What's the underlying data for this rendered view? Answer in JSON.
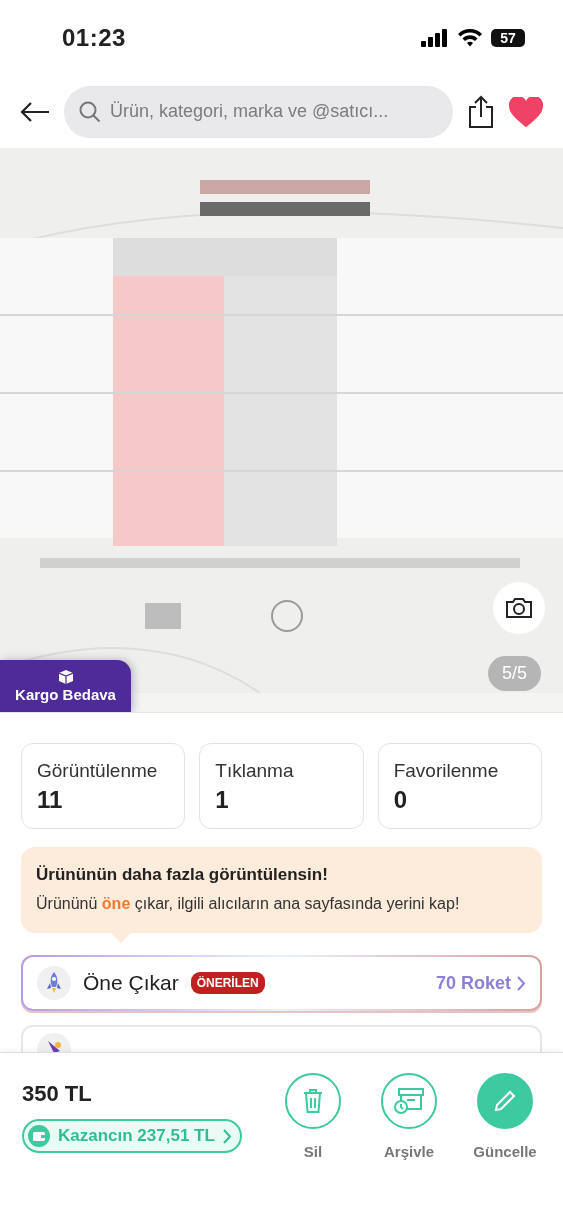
{
  "status_bar": {
    "time": "01:23",
    "battery": "57"
  },
  "header": {
    "search": {
      "placeholder": "Ürün, kategori, marka ve @satıcı..."
    },
    "favorite": true
  },
  "gallery": {
    "kind": "picture",
    "counter": "5/5",
    "badge": "Kargo Bedava"
  },
  "stats": [
    {
      "label": "Görüntülenme",
      "value": "11"
    },
    {
      "label": "Tıklanma",
      "value": "1"
    },
    {
      "label": "Favorilenme",
      "value": "0"
    }
  ],
  "promo": {
    "title": "Ürününün daha fazla görüntülensin!",
    "text": "Ürününü **öne** çıkar, ilgili alıcıların ana sayfasında yerini kap!"
  },
  "options": [
    {
      "kind": "boost",
      "label": "Öne Çıkar",
      "tag": "ÖNERİLEN",
      "price": "70 Roket"
    },
    {
      "kind": "campaign"
    }
  ],
  "bottom": {
    "price": "350 TL",
    "earnings": "Kazancın 237,51 TL",
    "actions": [
      {
        "kind": "delete",
        "label": "Sil"
      },
      {
        "kind": "archive",
        "label": "Arşivle"
      },
      {
        "kind": "edit",
        "label": "Güncelle"
      }
    ]
  }
}
